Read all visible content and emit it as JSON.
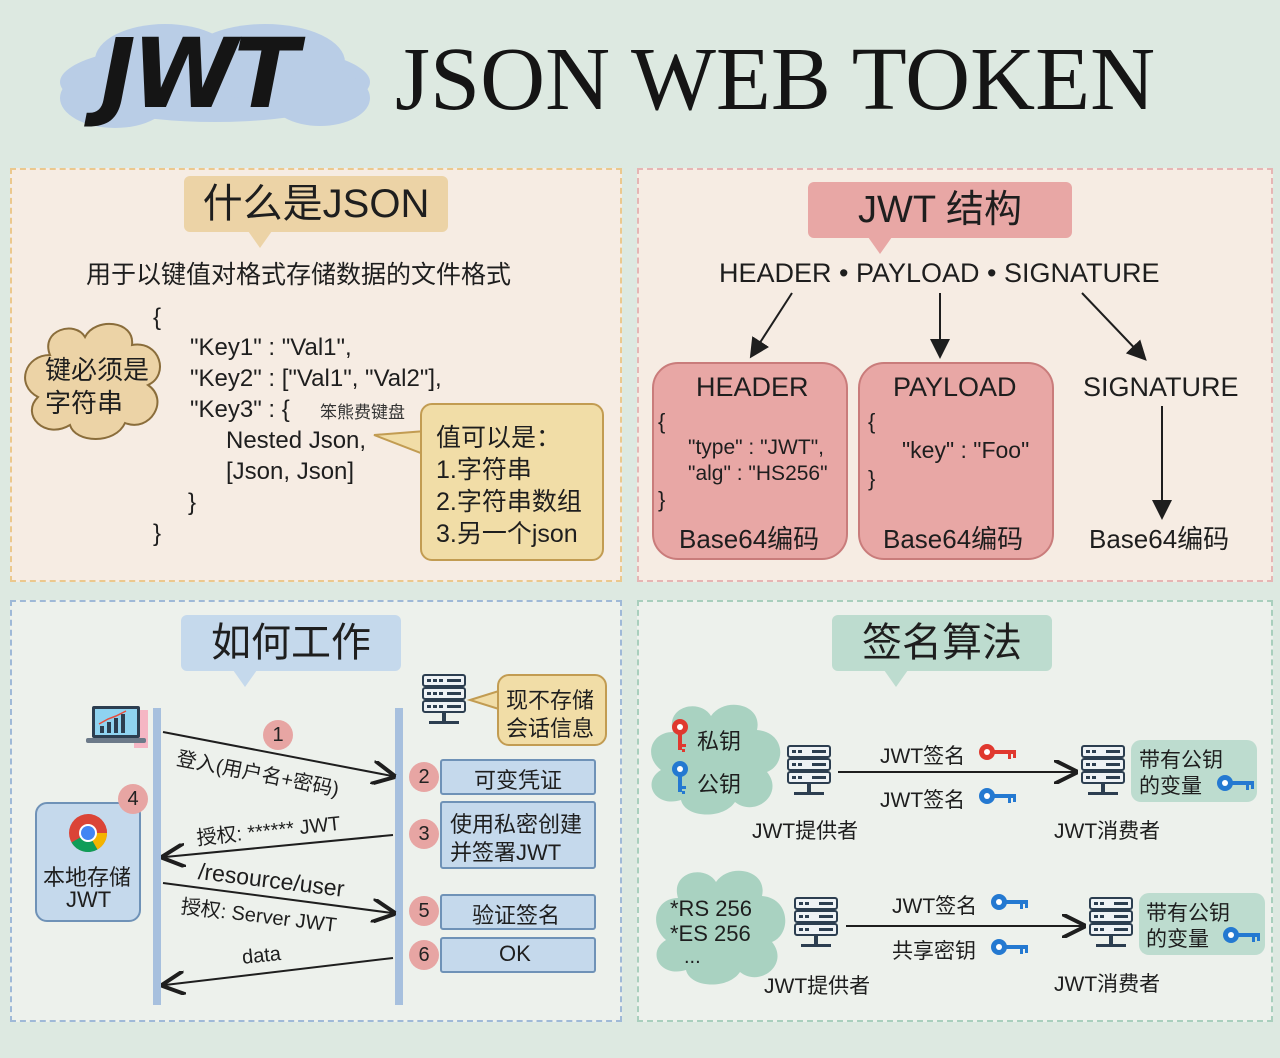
{
  "header": {
    "logo": "JWT",
    "title": "JSON WEB TOKEN"
  },
  "json_panel": {
    "title": "什么是JSON",
    "subtitle": "用于以键值对格式存储数据的文件格式",
    "code": {
      "open": "{",
      "line1": "\"Key1\" : \"Val1\",",
      "line2": "\"Key2\" : [\"Val1\", \"Val2\"],",
      "line3": "\"Key3\" : {",
      "line4": "Nested Json,",
      "line5": "[Json, Json]",
      "close_inner": "}",
      "close": "}"
    },
    "watermark": "笨熊费键盘",
    "cloud_text": [
      "键必须是",
      "字符串"
    ],
    "values_note": [
      "值可以是：",
      "1.字符串",
      "2.字符串数组",
      "3.另一个json"
    ]
  },
  "structure_panel": {
    "title": "JWT 结构",
    "formula": "HEADER • PAYLOAD • SIGNATURE",
    "header_box": {
      "title": "HEADER",
      "open": "{",
      "line1": "\"type\" : \"JWT\",",
      "line2": "\"alg\" : \"HS256\"",
      "close": "}",
      "encode": "Base64编码"
    },
    "payload_box": {
      "title": "PAYLOAD",
      "open": "{",
      "line1": "\"key\" : \"Foo\"",
      "close": "}",
      "encode": "Base64编码"
    },
    "signature": {
      "title": "SIGNATURE",
      "encode": "Base64编码"
    }
  },
  "work_panel": {
    "title": "如何工作",
    "server_note": [
      "现不存储",
      "会话信息"
    ],
    "storage_label": [
      "本地存储",
      "JWT"
    ],
    "steps": [
      {
        "num": "1",
        "label": "登入(用户名+密码)"
      },
      {
        "num": "2",
        "label": "可变凭证"
      },
      {
        "num": "3",
        "label": [
          "使用私密创建",
          "并签署JWT"
        ]
      },
      {
        "num": "4",
        "label": ""
      },
      {
        "num": "5",
        "label": "验证签名"
      },
      {
        "num": "6",
        "label": "OK"
      }
    ],
    "arrow_auth": "授权: ****** JWT",
    "arrow_resource": "/resource/user",
    "arrow_resource_auth": "授权: Server JWT",
    "arrow_data": "data"
  },
  "sign_panel": {
    "title": "签名算法",
    "row1": {
      "keys": [
        "私钥",
        "公钥"
      ],
      "msg_top": "JWT签名",
      "msg_bottom": "JWT签名",
      "provider": "JWT提供者",
      "consumer": "JWT消费者",
      "consumer_note": [
        "带有公钥",
        "的变量"
      ]
    },
    "row2": {
      "algos": [
        "*RS 256",
        "*ES 256",
        "..."
      ],
      "msg_top": "JWT签名",
      "msg_bottom": "共享密钥",
      "provider": "JWT提供者",
      "consumer": "JWT消费者",
      "consumer_note": [
        "带有公钥",
        "的变量"
      ]
    },
    "colors": {
      "private_key": "#e0392f",
      "public_key": "#2479d1"
    }
  }
}
